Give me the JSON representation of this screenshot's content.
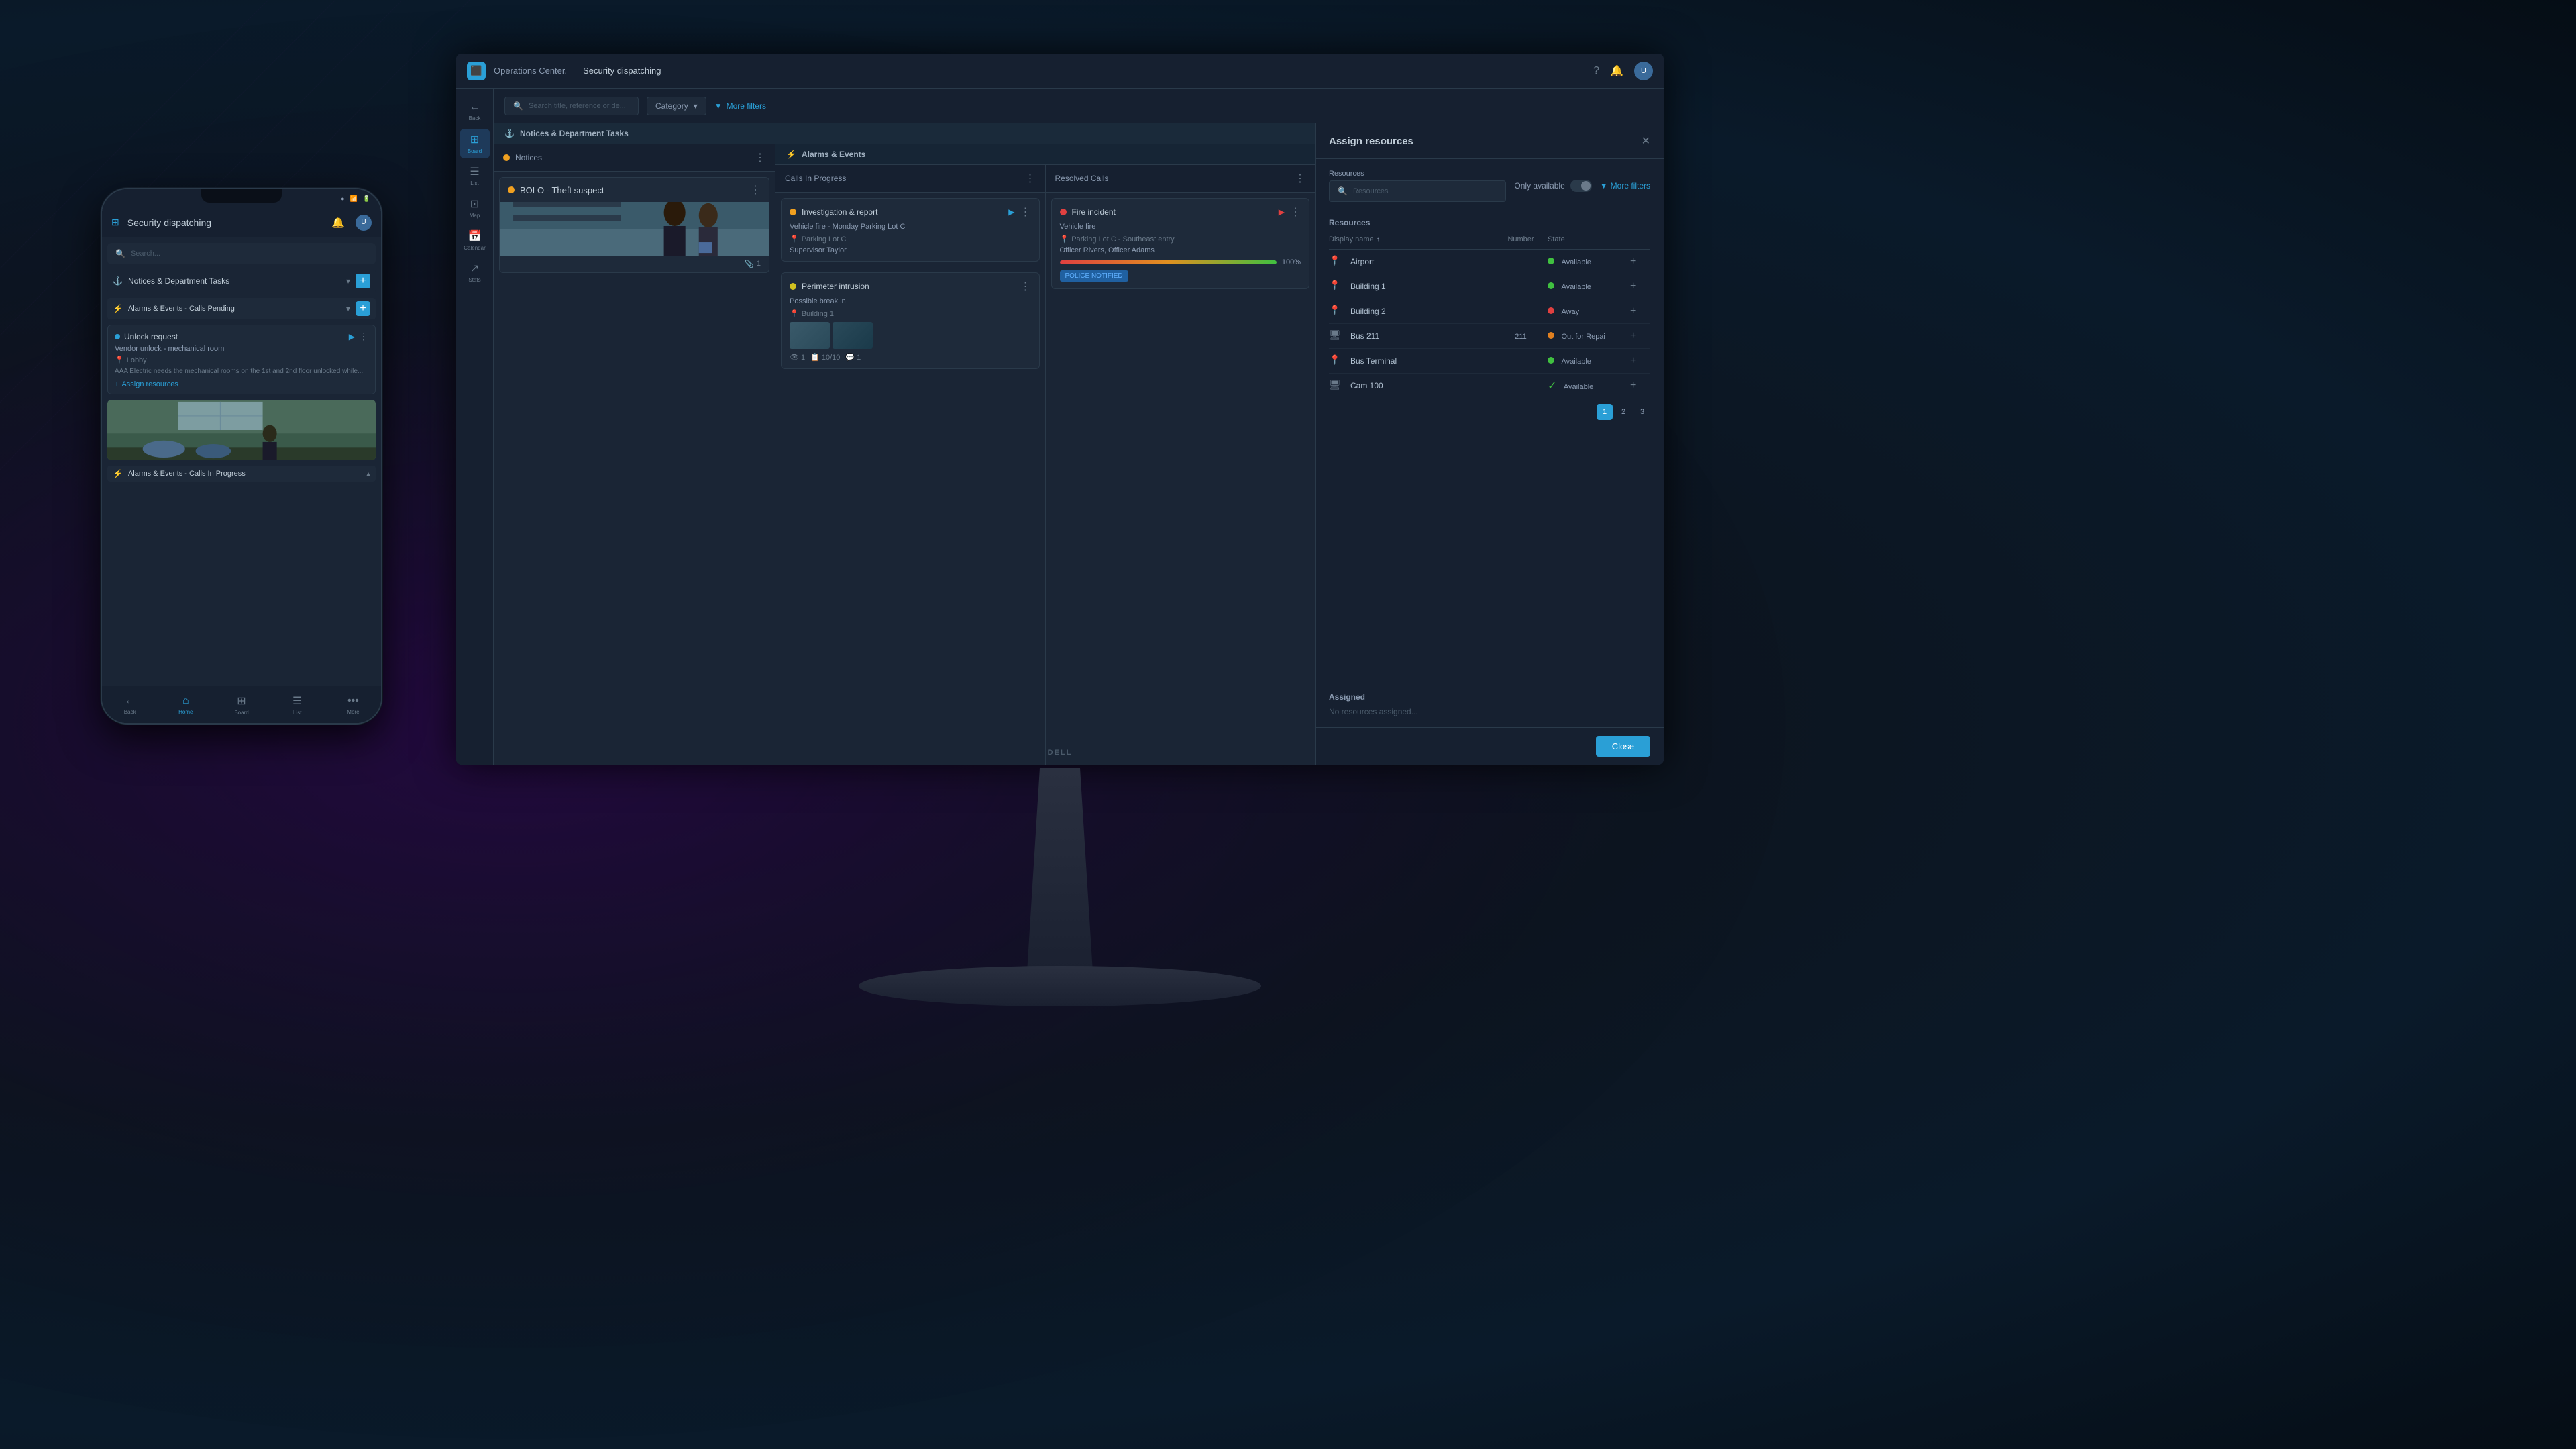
{
  "app": {
    "logo": "⬛",
    "name": "Operations Center.",
    "title": "Security dispatching",
    "titlebar_help": "?",
    "titlebar_bell": "🔔",
    "titlebar_user": "U"
  },
  "sidebar": {
    "items": [
      {
        "label": "Back",
        "icon": "←",
        "active": false
      },
      {
        "label": "Board",
        "icon": "⊞",
        "active": true
      },
      {
        "label": "List",
        "icon": "☰",
        "active": false
      },
      {
        "label": "Map",
        "icon": "⊡",
        "active": false
      },
      {
        "label": "Calendar",
        "icon": "📅",
        "active": false
      },
      {
        "label": "Stats",
        "icon": "↗",
        "active": false
      }
    ]
  },
  "toolbar": {
    "search_placeholder": "Search title, reference or de...",
    "category_label": "Category",
    "more_filters": "More filters"
  },
  "sections": {
    "notices_and_tasks": "Notices & Department Tasks",
    "alarms_and_events": "Alarms & Events"
  },
  "notices": {
    "header": "Notices",
    "bolo_title": "BOLO - Theft suspect",
    "attachment_count": "1"
  },
  "calls_in_progress": {
    "header": "Calls In Progress",
    "tasks": [
      {
        "dot_color": "orange",
        "title": "Investigation & report",
        "body": "Vehicle fire - Monday Parking Lot C",
        "location": "Parking Lot C",
        "people": "Supervisor Taylor",
        "play": true
      },
      {
        "dot_color": "yellow",
        "title": "Perimeter intrusion",
        "body": "Possible break in",
        "location": "Building 1",
        "play": false,
        "has_thumbs": true
      }
    ]
  },
  "resolved_calls": {
    "header": "Resolved Calls",
    "tasks": [
      {
        "dot_color": "red",
        "title": "Fire incident",
        "body": "Vehicle fire",
        "location": "Parking Lot C - Southeast entry",
        "people": "Officer Rivers, Officer Adams",
        "progress": 100,
        "badge": "POLICE NOTIFIED",
        "play": true
      }
    ]
  },
  "assign_panel": {
    "title": "Assign resources",
    "search_placeholder": "Resources",
    "only_available_label": "Only available",
    "more_filters": "More filters",
    "resources_label": "Resources",
    "col_display_name": "Display name",
    "col_number": "Number",
    "col_state": "State",
    "resources": [
      {
        "type": "location",
        "name": "Airport",
        "number": "",
        "state": "Available",
        "state_color": "green"
      },
      {
        "type": "location",
        "name": "Building 1",
        "number": "",
        "state": "Available",
        "state_color": "green"
      },
      {
        "type": "location",
        "name": "Building 2",
        "number": "",
        "state": "Away",
        "state_color": "red"
      },
      {
        "type": "device",
        "name": "Bus 211",
        "number": "211",
        "state": "Out for Repai",
        "state_color": "orange"
      },
      {
        "type": "location",
        "name": "Bus Terminal",
        "number": "",
        "state": "Available",
        "state_color": "green"
      },
      {
        "type": "device",
        "name": "Cam 100",
        "number": "",
        "state": "Available",
        "state_color": "check"
      }
    ],
    "pagination": [
      "1",
      "2",
      "3"
    ],
    "current_page": "1",
    "assigned_label": "Assigned",
    "no_resources": "No resources assigned...",
    "close_btn": "Close"
  },
  "mobile": {
    "app_title": "Security dispatching",
    "search_placeholder": "Search...",
    "sections": {
      "notices_tasks": "Notices & Department Tasks",
      "alarms_calls_pending": "Alarms & Events - Calls Pending",
      "alarms_calls_progress": "Alarms & Events - Calls In Progress"
    },
    "task": {
      "title": "Unlock request",
      "subtitle": "Vendor unlock - mechanical room",
      "location": "Lobby",
      "description": "AAA Electric needs the mechanical rooms on the 1st and 2nd floor unlocked while...",
      "assign_link": "Assign resources"
    },
    "nav": [
      {
        "label": "Back",
        "icon": "←",
        "active": false
      },
      {
        "label": "Home",
        "icon": "⌂",
        "active": true
      },
      {
        "label": "Board",
        "icon": "⊞",
        "active": false
      },
      {
        "label": "List",
        "icon": "☰",
        "active": false
      },
      {
        "label": "More",
        "icon": "•••",
        "active": false
      }
    ]
  }
}
